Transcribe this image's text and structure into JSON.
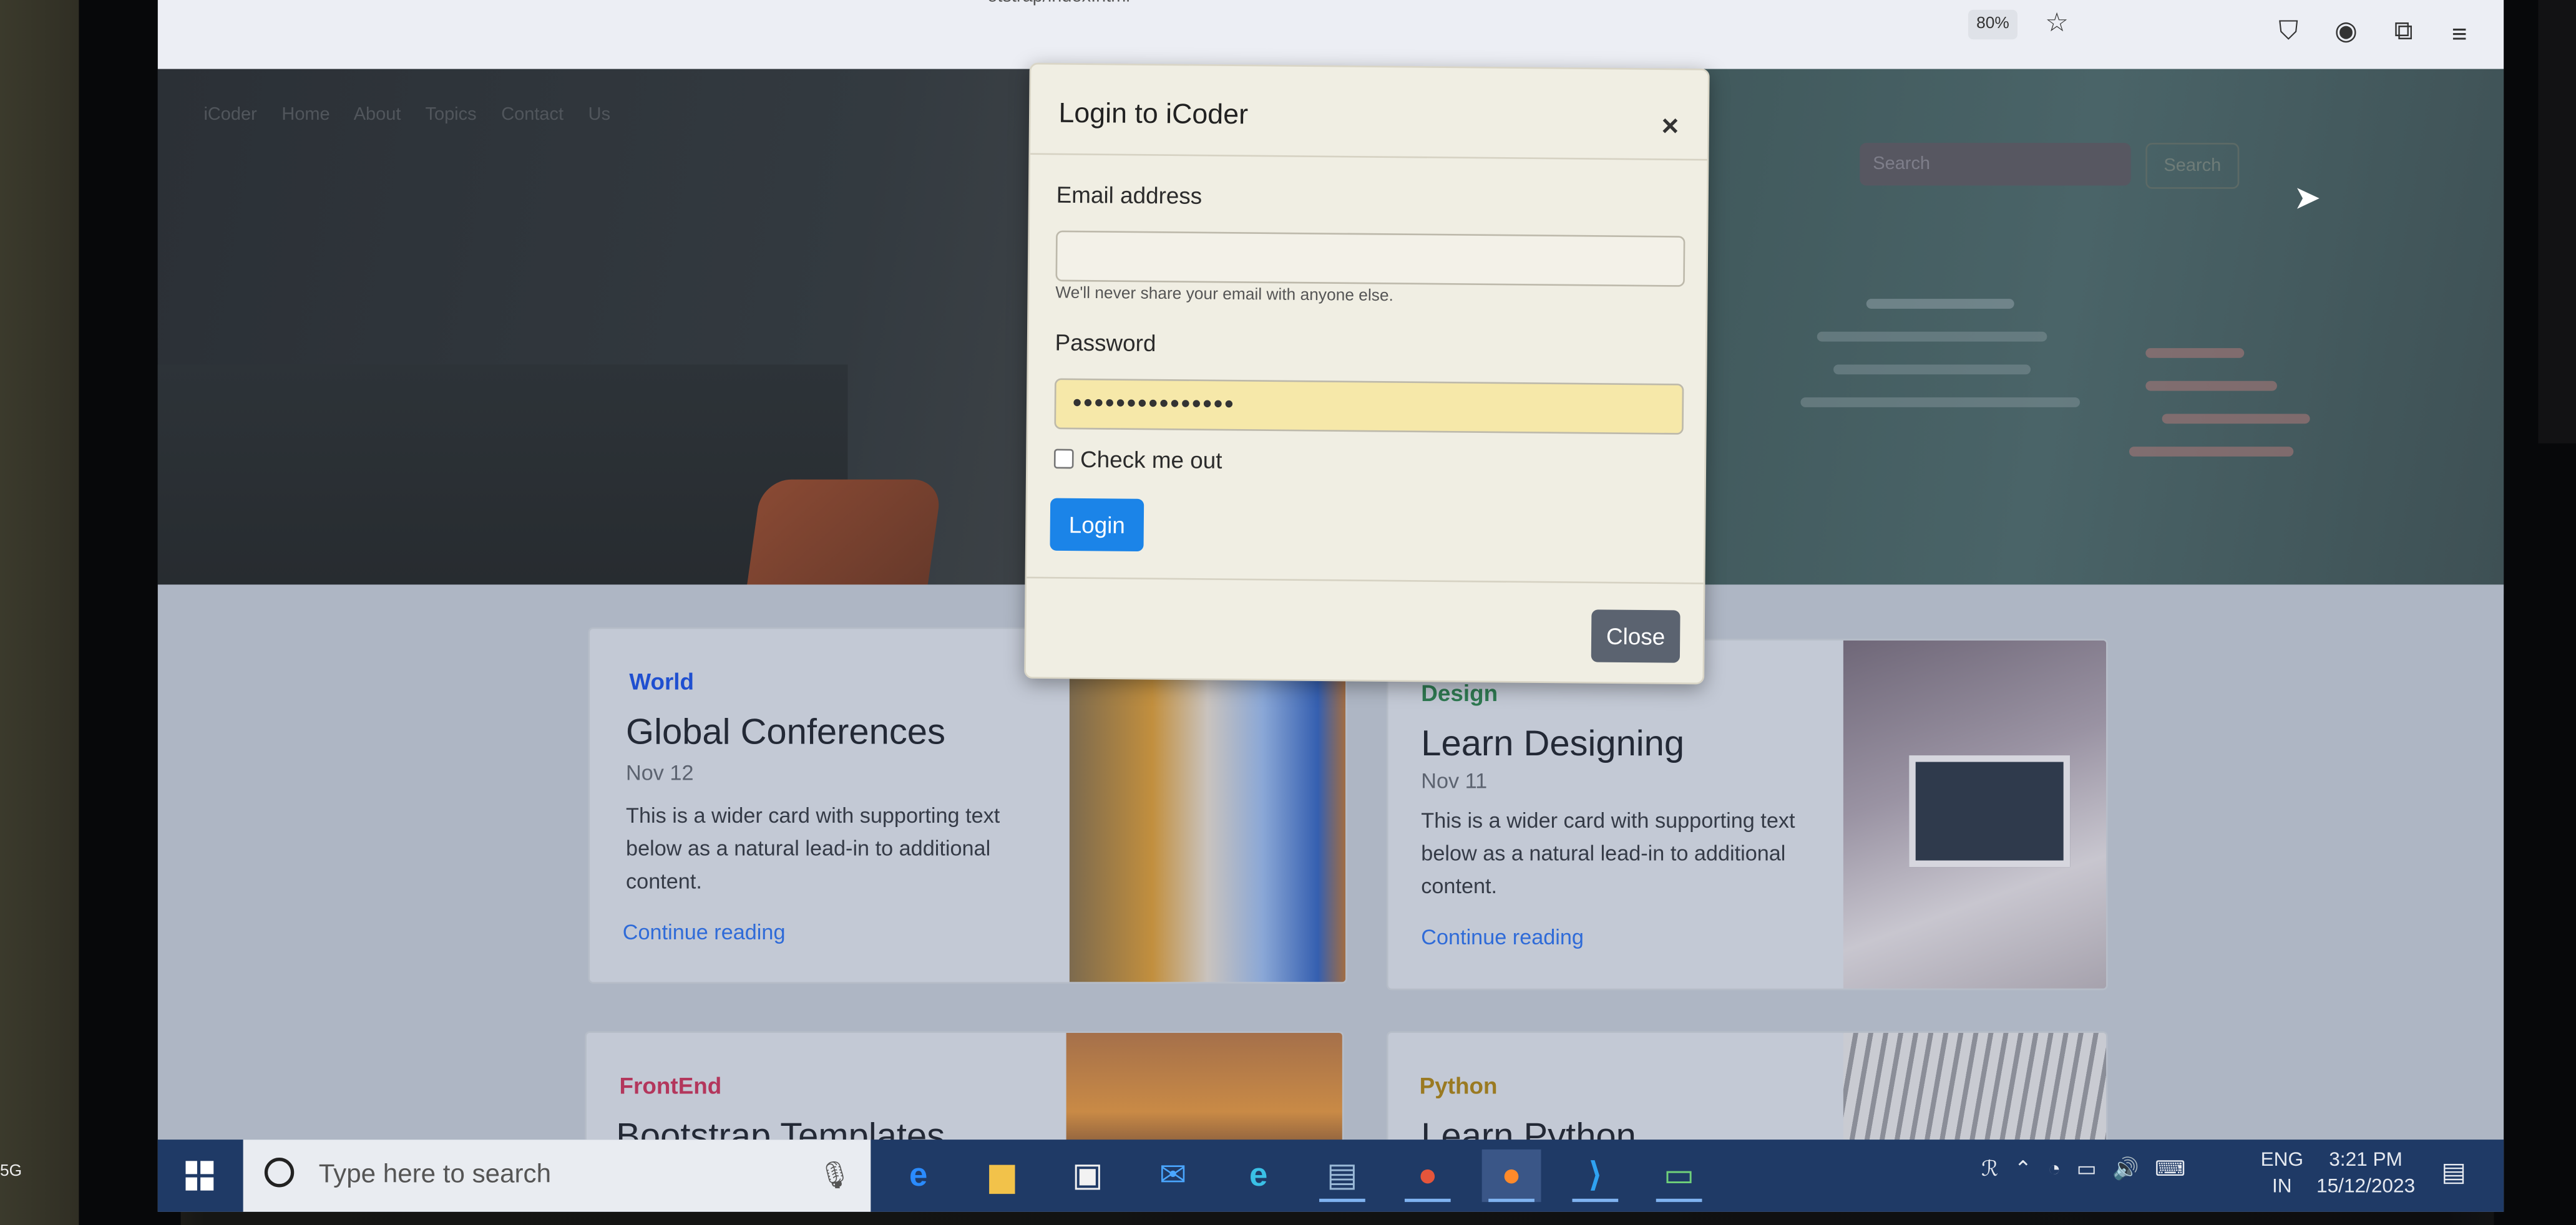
{
  "browser": {
    "url": "otstrap/index.html",
    "zoom": "80%",
    "icons": [
      "star-icon",
      "pocket-icon",
      "account-icon",
      "extensions-icon",
      "menu-icon"
    ]
  },
  "site": {
    "nav": "iCoder Home About Topics Contact Us",
    "search_placeholder": "Search",
    "search_button": "Search"
  },
  "modal": {
    "title": "Login to iCoder",
    "close_x": "×",
    "email_label": "Email address",
    "email_value": "",
    "email_help": "We'll never share your email with anyone else.",
    "password_label": "Password",
    "password_value": "•••••••••••••••",
    "checkbox_label": "Check me out",
    "login_button": "Login",
    "close_button": "Close"
  },
  "cards": [
    {
      "category": "World",
      "title": "Global Conferences",
      "date": "Nov 12",
      "text": "This is a wider card with supporting text below as a natural lead-in to additional content.",
      "link": "Continue reading",
      "cat_color": "#1f4fd0"
    },
    {
      "category": "Design",
      "title": "Learn Designing",
      "date": "Nov 11",
      "text": "This is a wider card with supporting text below as a natural lead-in to additional content.",
      "link": "Continue reading",
      "cat_color": "#2f7a52"
    },
    {
      "category": "FrontEnd",
      "title": "Bootstrap Templates",
      "cat_color": "#b3365c"
    },
    {
      "category": "Python",
      "title": "Learn Python",
      "cat_color": "#9a7a22"
    }
  ],
  "taskbar": {
    "search_placeholder": "Type here to search",
    "apps": [
      "ie-icon",
      "file-explorer-icon",
      "store-icon",
      "mail-icon",
      "edge-icon",
      "app-icon",
      "chrome-icon",
      "firefox-icon",
      "vscode-icon",
      "remote-desktop-icon"
    ],
    "language": "ENG",
    "region": "IN",
    "time": "3:21 PM",
    "date": "15/12/2023"
  },
  "colors": {
    "login_button": "#1b84e8",
    "close_button": "#5b6370",
    "password_autofill": "#f6e8a9",
    "taskbar": "#1f3a66"
  },
  "device_badge": "5G"
}
